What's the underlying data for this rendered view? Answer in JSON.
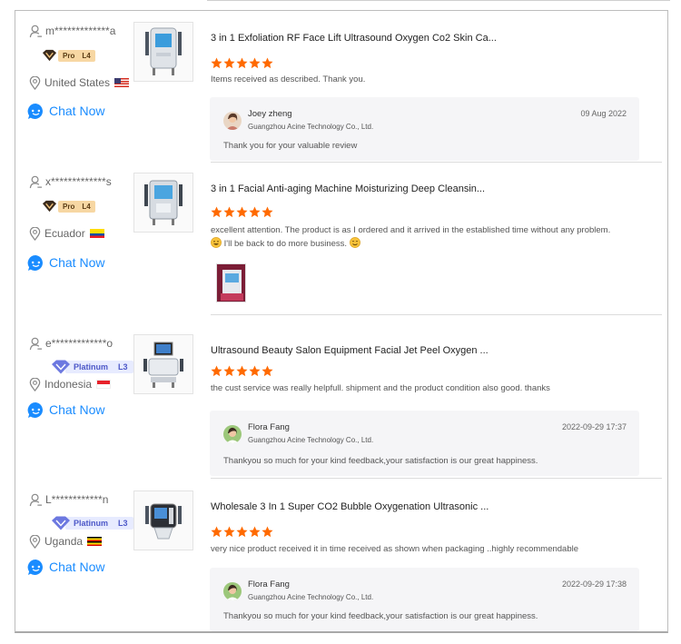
{
  "colors": {
    "accent": "#1a8cff",
    "star": "#ff6a00",
    "pro_badge": "#f7d7a3",
    "platinum_badge": "#e7ebff"
  },
  "reviews": [
    {
      "buyer": "m*************a",
      "badge": {
        "type": "pro",
        "label": "Pro",
        "level": "L4"
      },
      "country": "United States",
      "flag": "us-flag",
      "chat": "Chat Now",
      "product_title": "3 in 1 Exfoliation RF Face Lift Ultrasound Oxygen Co2 Skin Ca...",
      "rating": 5,
      "text": "Items received as described.  Thank you.",
      "reply": {
        "name": "Joey zheng",
        "company": "Guangzhou Acine Technology Co., Ltd.",
        "date": "09 Aug 2022",
        "text": "Thank you for your valuable review"
      }
    },
    {
      "buyer": "x*************s",
      "badge": {
        "type": "pro",
        "label": "Pro",
        "level": "L4"
      },
      "country": "Ecuador",
      "flag": "ecuador-flag",
      "chat": "Chat Now",
      "product_title": "3 in 1 Facial Anti-aging Machine Moisturizing Deep Cleansin...",
      "rating": 5,
      "text_line1": "excellent attention. The product is as I ordered and it arrived in the established time without any problem.",
      "text_line2": "I'll be back to do more business."
    },
    {
      "buyer": "e*************o",
      "badge": {
        "type": "platinum",
        "label": "Platinum",
        "level": "L3"
      },
      "country": "Indonesia",
      "flag": "indonesia-flag",
      "chat": "Chat Now",
      "product_title": "Ultrasound Beauty Salon Equipment Facial Jet Peel Oxygen ...",
      "rating": 5,
      "text": "the cust service was really helpfull. shipment and the product condition also good. thanks",
      "reply": {
        "name": "Flora Fang",
        "company": "Guangzhou Acine Technology Co., Ltd.",
        "date": "2022-09-29 17:37",
        "text": "Thankyou so much for your kind feedback,your satisfaction is our great happiness."
      }
    },
    {
      "buyer": "L************n",
      "badge": {
        "type": "platinum",
        "label": "Platinum",
        "level": "L3"
      },
      "country": "Uganda",
      "flag": "uganda-flag",
      "chat": "Chat Now",
      "product_title": "Wholesale 3 In 1 Super CO2 Bubble Oxygenation Ultrasonic ...",
      "rating": 5,
      "text": "very nice product received it in time received as shown when packaging ..highly recommendable",
      "reply": {
        "name": "Flora Fang",
        "company": "Guangzhou Acine Technology Co., Ltd.",
        "date": "2022-09-29 17:38",
        "text": "Thankyou so much for your kind feedback,your satisfaction is our great happiness."
      }
    }
  ]
}
